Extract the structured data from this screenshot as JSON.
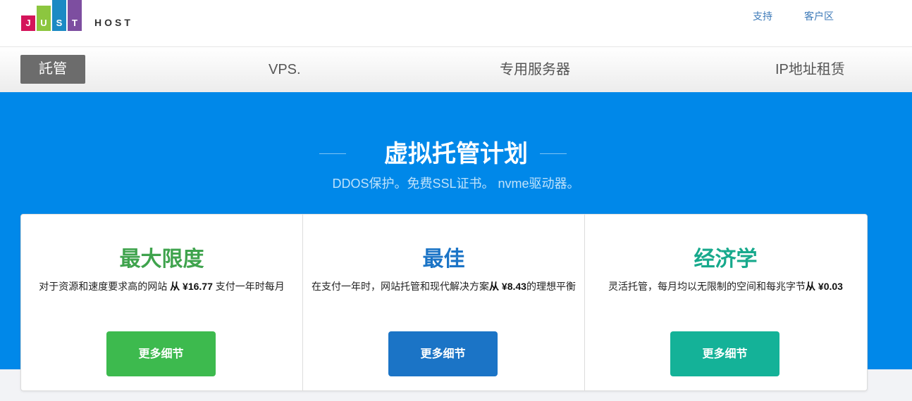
{
  "logo": {
    "letters": [
      "J",
      "U",
      "S",
      "T"
    ],
    "colors": [
      "#d4145a",
      "#8cc63f",
      "#1b8ac4",
      "#7d4ea0"
    ],
    "host": "HOST"
  },
  "top_links": {
    "support": "支持",
    "client_area": "客户区"
  },
  "nav": {
    "items": [
      "託管",
      "VPS.",
      "专用服务器",
      "IP地址租赁"
    ],
    "active_index": 0
  },
  "hero": {
    "title": "虚拟托管计划",
    "subtitle": "DDOS保护。免费SSL证书。 nvme驱动器。"
  },
  "plans": [
    {
      "title": "最大限度",
      "title_color": "#3fa34d",
      "desc_before": "对于资源和速度要求高的网站 ",
      "price": "从 ¥16.77",
      "desc_after": " 支付一年时每月",
      "button": "更多细节",
      "button_color": "#3dba4e"
    },
    {
      "title": "最佳",
      "title_color": "#1b74c6",
      "desc_before": "在支付一年时，网站托管和现代解决方案",
      "price": "从 ¥8.43",
      "desc_after": "的理想平衡",
      "button": "更多细节",
      "button_color": "#1b74c6"
    },
    {
      "title": "经济学",
      "title_color": "#17a98c",
      "desc_before": "灵活托管，每月均以无限制的空间和每兆字节",
      "price": "从 ¥0.03",
      "desc_after": "",
      "button": "更多细节",
      "button_color": "#14b298"
    }
  ]
}
